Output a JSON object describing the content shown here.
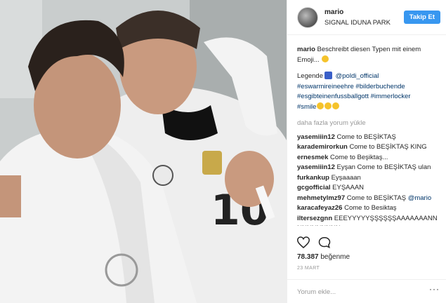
{
  "header": {
    "username": "mario",
    "location": "SIGNAL IDUNA PARK",
    "follow_label": "Takip Et"
  },
  "caption": {
    "username": "mario",
    "text": "Beschreibt diesen Typen mit einem Emoji...",
    "legend_word": "Legende",
    "mention": "@poldi_official",
    "hashtags_line1": "#eswarmireineehre #bilderbuchende",
    "hashtags_line2": "#esgibteinenfussballgott #immerlocker",
    "hashtags_line3": "#smile"
  },
  "load_more": "daha fazla yorum yükle",
  "comments": [
    {
      "user": "yasemiiin12",
      "text": "Come to BEŞİKTAŞ"
    },
    {
      "user": "karademirorkun",
      "text": "Come to BEŞİKTAŞ KING"
    },
    {
      "user": "ernesmek",
      "text": "Come to Beşiktaş..."
    },
    {
      "user": "yasemiiin12",
      "text": "Eyşan Come to BEŞİKTAŞ ulan"
    },
    {
      "user": "furkankup",
      "text": "Eyşaaaan"
    },
    {
      "user": "gcgofficial",
      "text": "EYŞAAAN"
    },
    {
      "user": "mehmetylmz97",
      "text": "Come to BEŞİKTAŞ",
      "mention": "@mario"
    },
    {
      "user": "karacafeyaz26",
      "text": "Come to Besiktaş"
    },
    {
      "user": "iltersezgnn",
      "text": "EEEYYYYYŞŞŞŞŞŞAAAAAAANN NNNNNNNNN"
    }
  ],
  "likes": {
    "count": "78.387",
    "label": "beğenme"
  },
  "date": "23 MART",
  "add_comment_placeholder": "Yorum ekle...",
  "icons": {
    "like": "heart-icon",
    "comment": "comment-bubble-icon",
    "more": "more-dots-icon"
  },
  "colors": {
    "follow_button": "#3897f0",
    "link": "#003569",
    "muted": "#999999"
  }
}
